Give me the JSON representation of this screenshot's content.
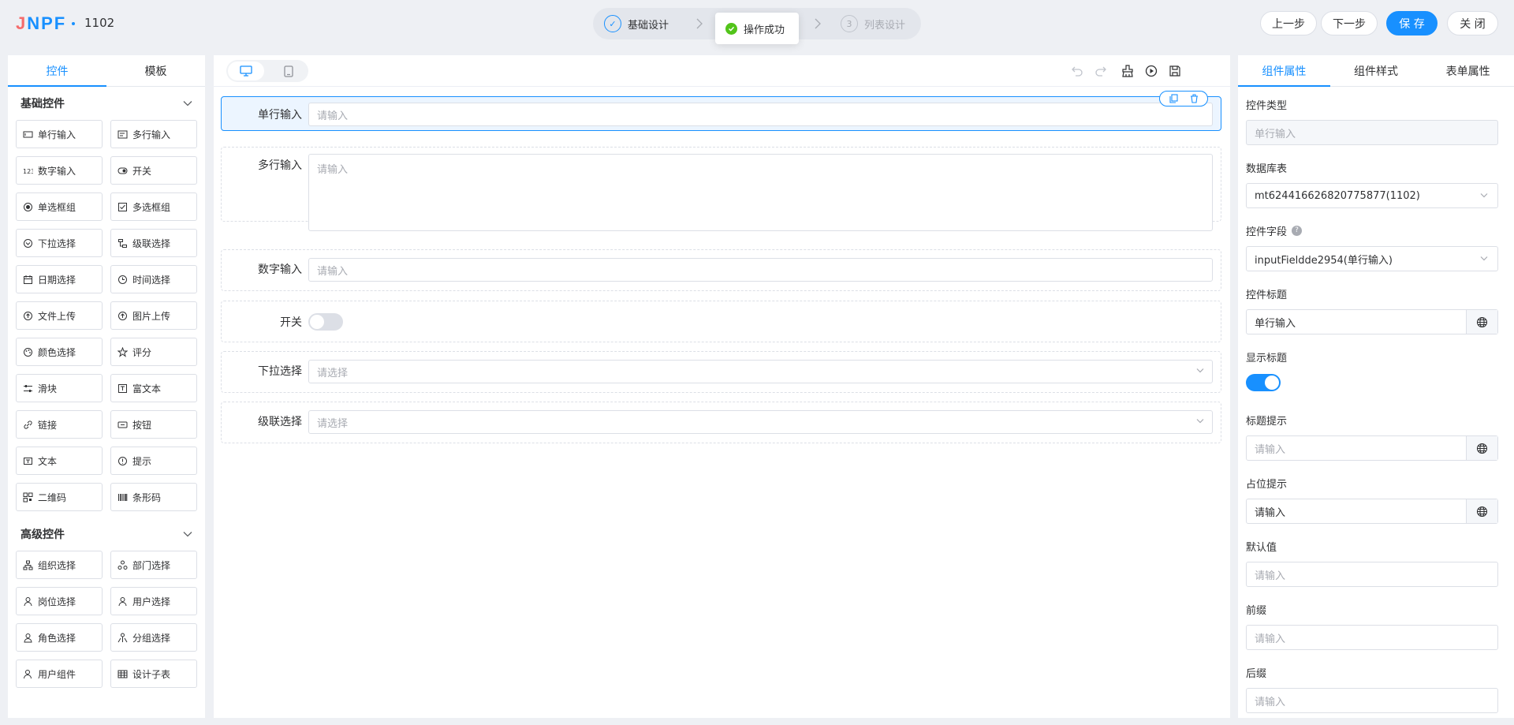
{
  "header": {
    "logo_part1": "J",
    "logo_part2": "NPF",
    "title": "1102",
    "steps": [
      {
        "num": "✓",
        "label": "基础设计"
      },
      {
        "num": "3",
        "label": "列表设计"
      }
    ],
    "toast": "操作成功",
    "buttons": {
      "prev": "上一步",
      "next": "下一步",
      "save": "保 存",
      "close": "关 闭"
    }
  },
  "left_panel": {
    "tabs": [
      "控件",
      "模板"
    ],
    "basic_group": "基础控件",
    "basic_widgets": [
      {
        "label": "单行输入",
        "icon": "input-icon"
      },
      {
        "label": "多行输入",
        "icon": "textarea-icon"
      },
      {
        "label": "数字输入",
        "icon": "number-icon"
      },
      {
        "label": "开关",
        "icon": "switch-icon"
      },
      {
        "label": "单选框组",
        "icon": "radio-icon"
      },
      {
        "label": "多选框组",
        "icon": "checkbox-icon"
      },
      {
        "label": "下拉选择",
        "icon": "select-icon"
      },
      {
        "label": "级联选择",
        "icon": "cascader-icon"
      },
      {
        "label": "日期选择",
        "icon": "calendar-icon"
      },
      {
        "label": "时间选择",
        "icon": "clock-icon"
      },
      {
        "label": "文件上传",
        "icon": "upload-icon"
      },
      {
        "label": "图片上传",
        "icon": "image-upload-icon"
      },
      {
        "label": "颜色选择",
        "icon": "palette-icon"
      },
      {
        "label": "评分",
        "icon": "star-icon"
      },
      {
        "label": "滑块",
        "icon": "slider-icon"
      },
      {
        "label": "富文本",
        "icon": "richtext-icon"
      },
      {
        "label": "链接",
        "icon": "link-icon"
      },
      {
        "label": "按钮",
        "icon": "button-icon"
      },
      {
        "label": "文本",
        "icon": "text-icon"
      },
      {
        "label": "提示",
        "icon": "alert-icon"
      },
      {
        "label": "二维码",
        "icon": "qrcode-icon"
      },
      {
        "label": "条形码",
        "icon": "barcode-icon"
      }
    ],
    "advanced_group": "高级控件",
    "advanced_widgets": [
      {
        "label": "组织选择",
        "icon": "org-icon"
      },
      {
        "label": "部门选择",
        "icon": "dept-icon"
      },
      {
        "label": "岗位选择",
        "icon": "position-icon"
      },
      {
        "label": "用户选择",
        "icon": "user-icon"
      },
      {
        "label": "角色选择",
        "icon": "role-icon"
      },
      {
        "label": "分组选择",
        "icon": "group-icon"
      },
      {
        "label": "用户组件",
        "icon": "user-component-icon"
      },
      {
        "label": "设计子表",
        "icon": "table-icon"
      }
    ]
  },
  "canvas": {
    "fields": [
      {
        "label": "单行输入",
        "placeholder": "请输入"
      },
      {
        "label": "多行输入",
        "placeholder": "请输入"
      },
      {
        "label": "数字输入",
        "placeholder": "请输入"
      },
      {
        "label": "开关"
      },
      {
        "label": "下拉选择",
        "placeholder": "请选择"
      },
      {
        "label": "级联选择",
        "placeholder": "请选择"
      }
    ]
  },
  "right_panel": {
    "tabs": [
      "组件属性",
      "组件样式",
      "表单属性"
    ],
    "props": {
      "type_label": "控件类型",
      "type_value": "单行输入",
      "table_label": "数据库表",
      "table_value": "mt624416626820775877(1102)",
      "field_label": "控件字段",
      "field_help": "?",
      "field_value": "inputFieldde2954(单行输入)",
      "title_label": "控件标题",
      "title_value": "单行输入",
      "show_title_label": "显示标题",
      "show_title": true,
      "title_tip_label": "标题提示",
      "title_tip_placeholder": "请输入",
      "placeholder_label": "占位提示",
      "placeholder_value": "请输入",
      "default_label": "默认值",
      "default_placeholder": "请输入",
      "prefix_label": "前缀",
      "prefix_placeholder": "请输入",
      "suffix_label": "后缀",
      "suffix_placeholder": "请输入"
    }
  },
  "colors": {
    "accent": "#1890ff",
    "success": "#52c41a",
    "logo_red": "#f56c6c"
  }
}
